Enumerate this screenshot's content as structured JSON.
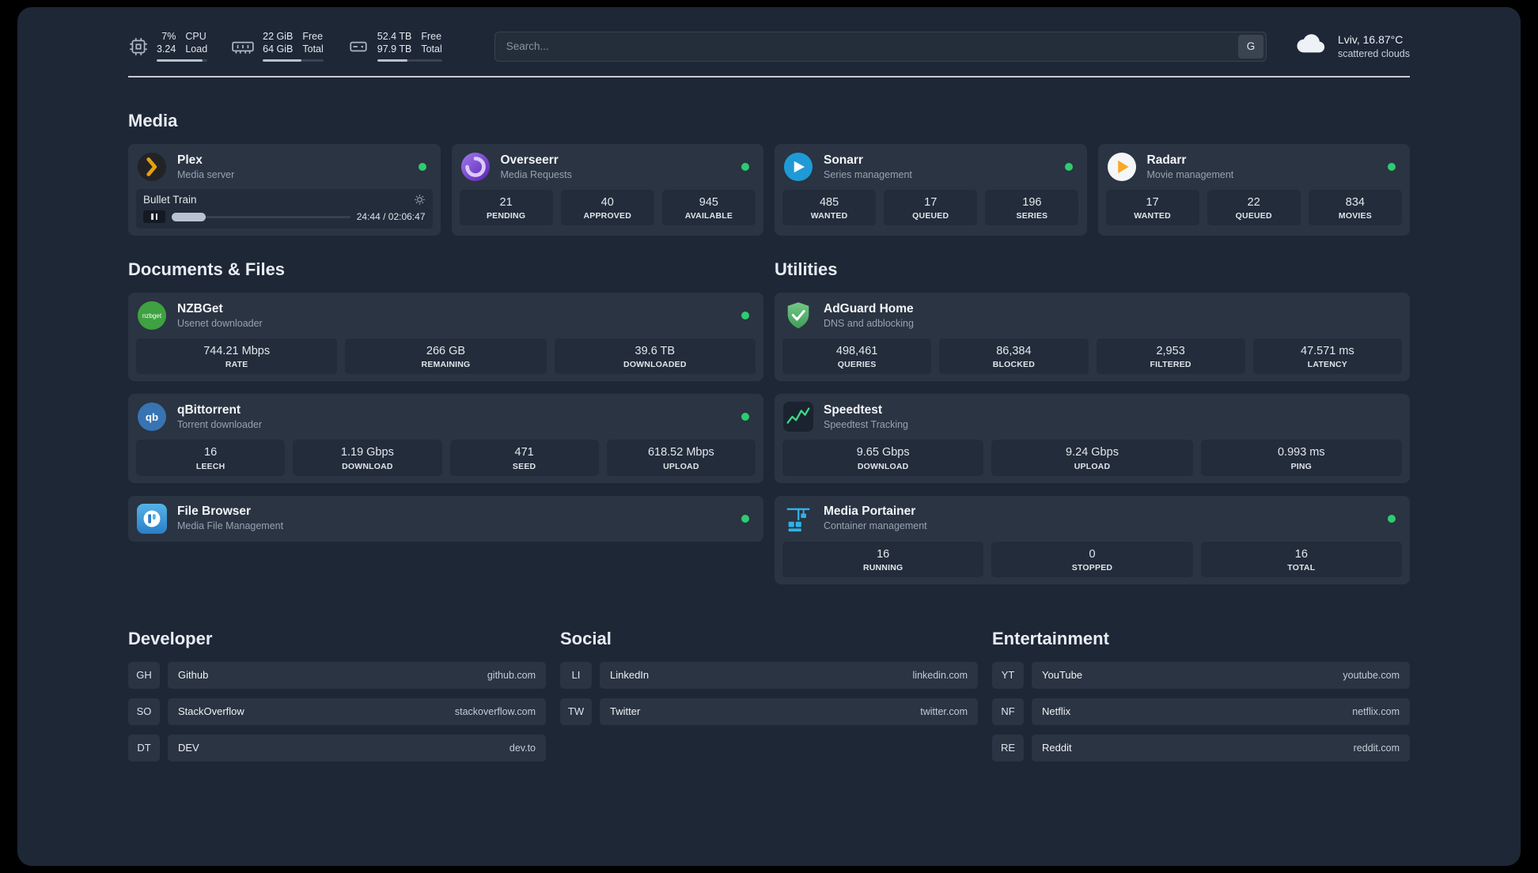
{
  "topbar": {
    "cpu": {
      "value1": "7%",
      "value2": "3.24",
      "label1": "CPU",
      "label2": "Load",
      "bar_pct": 90
    },
    "memory": {
      "value1": "22 GiB",
      "value2": "64 GiB",
      "label1": "Free",
      "label2": "Total",
      "bar_pct": 64
    },
    "disk": {
      "value1": "52.4 TB",
      "value2": "97.9 TB",
      "label1": "Free",
      "label2": "Total",
      "bar_pct": 47
    },
    "search": {
      "placeholder": "Search...",
      "engine_button": "G"
    },
    "weather": {
      "location": "Lviv, 16.87°C",
      "condition": "scattered clouds"
    }
  },
  "colors": {
    "status_online": "#2ecc71",
    "accent_green": "#3ddc84"
  },
  "sections": {
    "media": {
      "title": "Media",
      "cards": [
        {
          "name": "Plex",
          "subtitle": "Media server",
          "status": "online",
          "player": {
            "track": "Bullet Train",
            "time": "24:44 / 02:06:47",
            "progress_pct": 19
          }
        },
        {
          "name": "Overseerr",
          "subtitle": "Media Requests",
          "status": "online",
          "stats": [
            {
              "value": "21",
              "label": "PENDING"
            },
            {
              "value": "40",
              "label": "APPROVED"
            },
            {
              "value": "945",
              "label": "AVAILABLE"
            }
          ]
        },
        {
          "name": "Sonarr",
          "subtitle": "Series management",
          "status": "online",
          "stats": [
            {
              "value": "485",
              "label": "WANTED"
            },
            {
              "value": "17",
              "label": "QUEUED"
            },
            {
              "value": "196",
              "label": "SERIES"
            }
          ]
        },
        {
          "name": "Radarr",
          "subtitle": "Movie management",
          "status": "online",
          "stats": [
            {
              "value": "17",
              "label": "WANTED"
            },
            {
              "value": "22",
              "label": "QUEUED"
            },
            {
              "value": "834",
              "label": "MOVIES"
            }
          ]
        }
      ]
    },
    "documents": {
      "title": "Documents & Files",
      "cards": [
        {
          "name": "NZBGet",
          "subtitle": "Usenet downloader",
          "status": "online",
          "stats": [
            {
              "value": "744.21 Mbps",
              "label": "RATE"
            },
            {
              "value": "266 GB",
              "label": "REMAINING"
            },
            {
              "value": "39.6 TB",
              "label": "DOWNLOADED"
            }
          ]
        },
        {
          "name": "qBittorrent",
          "subtitle": "Torrent downloader",
          "status": "online",
          "stats": [
            {
              "value": "16",
              "label": "LEECH"
            },
            {
              "value": "1.19 Gbps",
              "label": "DOWNLOAD"
            },
            {
              "value": "471",
              "label": "SEED"
            },
            {
              "value": "618.52 Mbps",
              "label": "UPLOAD"
            }
          ]
        },
        {
          "name": "File Browser",
          "subtitle": "Media File Management",
          "status": "online"
        }
      ]
    },
    "utilities": {
      "title": "Utilities",
      "cards": [
        {
          "name": "AdGuard Home",
          "subtitle": "DNS and adblocking",
          "stats": [
            {
              "value": "498,461",
              "label": "QUERIES"
            },
            {
              "value": "86,384",
              "label": "BLOCKED"
            },
            {
              "value": "2,953",
              "label": "FILTERED"
            },
            {
              "value": "47.571 ms",
              "label": "LATENCY"
            }
          ]
        },
        {
          "name": "Speedtest",
          "subtitle": "Speedtest Tracking",
          "stats": [
            {
              "value": "9.65 Gbps",
              "label": "DOWNLOAD"
            },
            {
              "value": "9.24 Gbps",
              "label": "UPLOAD"
            },
            {
              "value": "0.993 ms",
              "label": "PING"
            }
          ]
        },
        {
          "name": "Media Portainer",
          "subtitle": "Container management",
          "status": "online",
          "stats": [
            {
              "value": "16",
              "label": "RUNNING"
            },
            {
              "value": "0",
              "label": "STOPPED"
            },
            {
              "value": "16",
              "label": "TOTAL"
            }
          ]
        }
      ]
    },
    "developer": {
      "title": "Developer",
      "links": [
        {
          "abbr": "GH",
          "name": "Github",
          "url": "github.com"
        },
        {
          "abbr": "SO",
          "name": "StackOverflow",
          "url": "stackoverflow.com"
        },
        {
          "abbr": "DT",
          "name": "DEV",
          "url": "dev.to"
        }
      ]
    },
    "social": {
      "title": "Social",
      "links": [
        {
          "abbr": "LI",
          "name": "LinkedIn",
          "url": "linkedin.com"
        },
        {
          "abbr": "TW",
          "name": "Twitter",
          "url": "twitter.com"
        }
      ]
    },
    "entertainment": {
      "title": "Entertainment",
      "links": [
        {
          "abbr": "YT",
          "name": "YouTube",
          "url": "youtube.com"
        },
        {
          "abbr": "NF",
          "name": "Netflix",
          "url": "netflix.com"
        },
        {
          "abbr": "RE",
          "name": "Reddit",
          "url": "reddit.com"
        }
      ]
    }
  }
}
